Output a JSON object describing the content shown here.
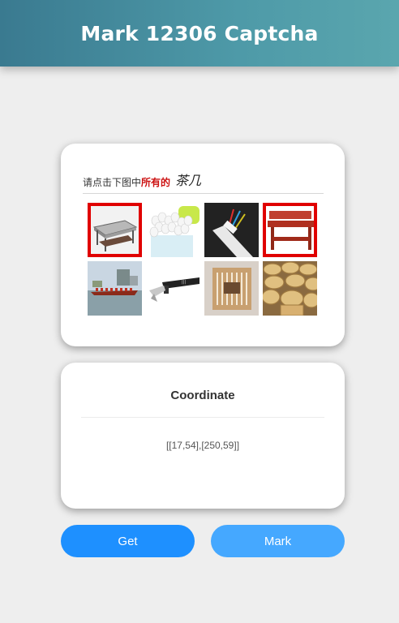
{
  "header": {
    "title": "Mark 12306 Captcha"
  },
  "captcha": {
    "prompt_prefix": "请点击下图中",
    "prompt_highlight": "所有的",
    "target_word": "茶几",
    "tiles": [
      {
        "icon": "coffee-table-image",
        "selected": true
      },
      {
        "icon": "cotton-swabs-image",
        "selected": false
      },
      {
        "icon": "electric-cable-image",
        "selected": false
      },
      {
        "icon": "coffee-table-image",
        "selected": true
      },
      {
        "icon": "dragon-boat-image",
        "selected": false
      },
      {
        "icon": "lighter-image",
        "selected": false
      },
      {
        "icon": "cotton-swabs-image",
        "selected": false
      },
      {
        "icon": "bamboo-steamer-image",
        "selected": false
      }
    ]
  },
  "coordinate": {
    "title": "Coordinate",
    "value": "[[17,54],[250,59]]"
  },
  "buttons": {
    "get_label": "Get",
    "mark_label": "Mark"
  },
  "colors": {
    "header_start": "#3a7a90",
    "header_end": "#5aa6ae",
    "get_button": "#1e90ff",
    "mark_button": "#45a8ff",
    "selection_border": "#e00000",
    "highlight_text": "#cc1111"
  }
}
